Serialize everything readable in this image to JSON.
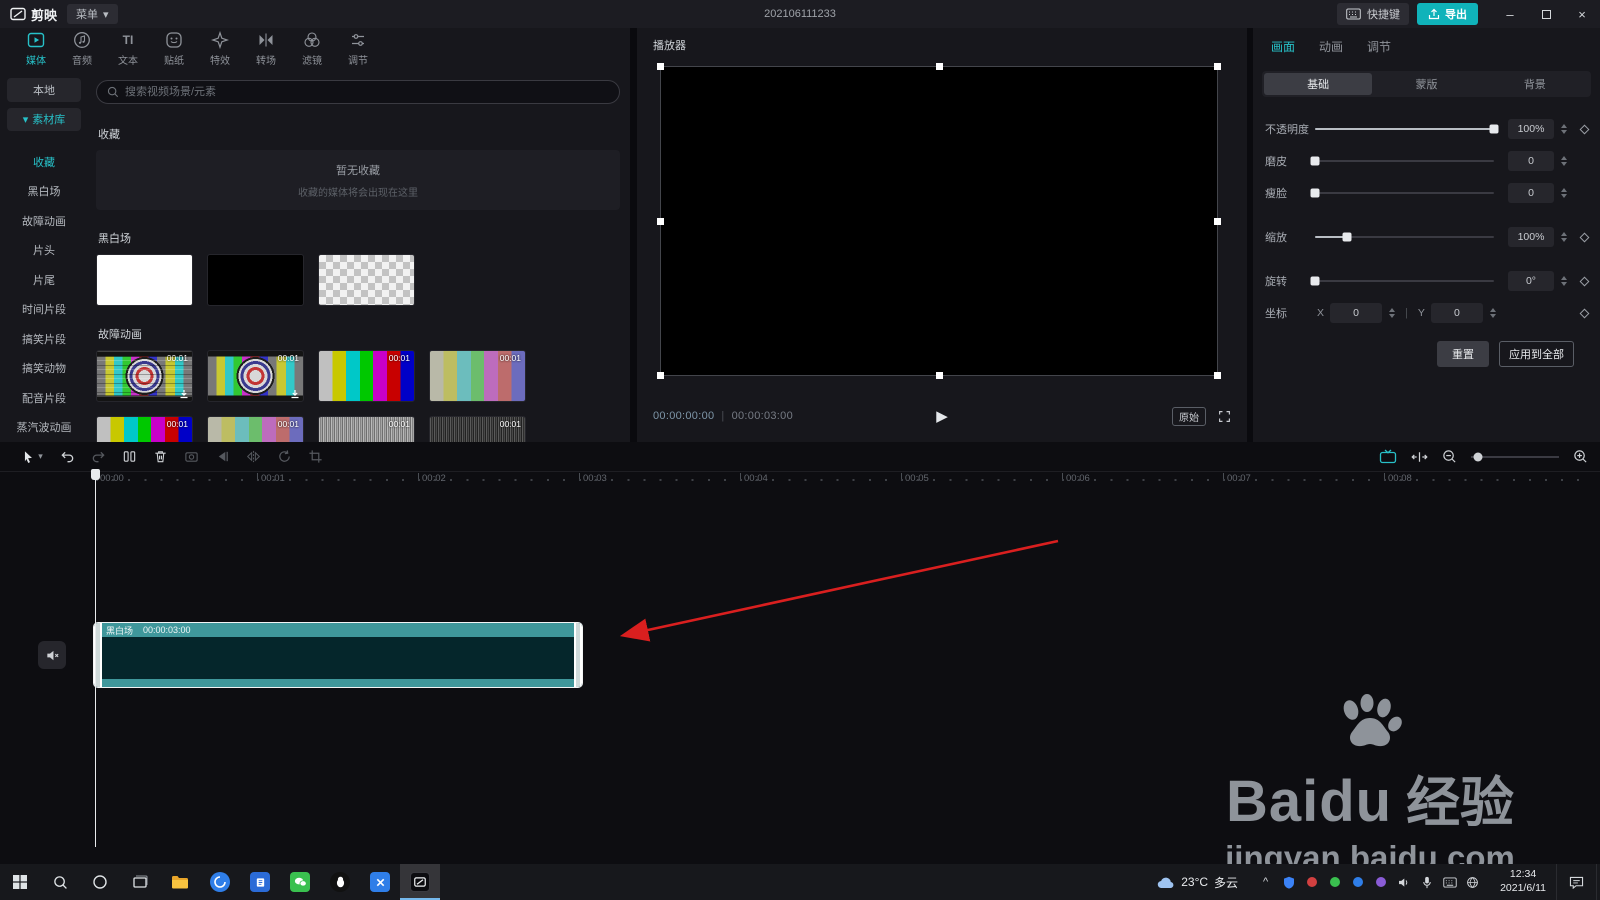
{
  "icons": {
    "menu_caret": "▾",
    "library_caret": "▾",
    "minimize_glyph": "–",
    "close_glyph": "×",
    "play_glyph": "▶",
    "timecode_divider": "|",
    "coord_divider": "|",
    "text_tab_glyph": "TI",
    "tray_chevron": "^"
  },
  "titlebar": {
    "app_name": "剪映",
    "menu_label": "菜单",
    "doc_title": "202106111233",
    "shortcuts_label": "快捷键",
    "export_label": "导出"
  },
  "media_tabs": [
    {
      "label": "媒体"
    },
    {
      "label": "音频"
    },
    {
      "label": "文本"
    },
    {
      "label": "贴纸"
    },
    {
      "label": "特效"
    },
    {
      "label": "转场"
    },
    {
      "label": "滤镜"
    },
    {
      "label": "调节"
    }
  ],
  "library": {
    "local_label": "本地",
    "library_label": "素材库",
    "categories": [
      "收藏",
      "黑白场",
      "故障动画",
      "片头",
      "片尾",
      "时间片段",
      "搞笑片段",
      "搞笑动物",
      "配音片段",
      "蒸汽波动画"
    ],
    "search_placeholder": "搜索视频场景/元素",
    "favorites_title": "收藏",
    "favorites_empty_title": "暂无收藏",
    "favorites_empty_desc": "收藏的媒体将会出现在这里",
    "bw_title": "黑白场",
    "glitch_title": "故障动画",
    "clip_duration_badge": "00:01"
  },
  "player": {
    "title": "播放器",
    "current_time": "00:00:00:00",
    "total_duration": "00:00:03:00",
    "original_label": "原始"
  },
  "properties": {
    "tabs": [
      {
        "label": "画面"
      },
      {
        "label": "动画"
      },
      {
        "label": "调节"
      }
    ],
    "sub_tabs": [
      {
        "label": "基础"
      },
      {
        "label": "蒙版"
      },
      {
        "label": "背景"
      }
    ],
    "controls": [
      {
        "label": "不透明度",
        "value": "100%"
      },
      {
        "label": "磨皮",
        "value": "0"
      },
      {
        "label": "瘦脸",
        "value": "0"
      },
      {
        "label": "缩放",
        "value": "100%"
      },
      {
        "label": "旋转",
        "value": "0°"
      }
    ],
    "coord": {
      "label": "坐标",
      "x_label": "X",
      "x_value": "0",
      "y_label": "Y",
      "y_value": "0"
    },
    "reset_label": "重置",
    "apply_all_label": "应用到全部"
  },
  "timeline": {
    "ruler_labels": [
      "00:00",
      "00:01",
      "00:02",
      "00:03",
      "00:04",
      "00:05",
      "00:06",
      "00:07",
      "00:08"
    ],
    "clip": {
      "label": "黑白场",
      "duration": "00:00:03:00"
    }
  },
  "watermark": {
    "brand_latin": "Baidu",
    "brand_cn": "经验",
    "url": "jingyan.baidu.com"
  },
  "taskbar": {
    "weather_temp": "23°C",
    "weather_desc": "多云",
    "time": "12:34",
    "date": "2021/6/11"
  },
  "colors": {
    "accent": "#27c2c9",
    "export_button": "#10b3ba",
    "clip_strip": "#3f979b",
    "annotation_arrow": "#d91f1f"
  }
}
